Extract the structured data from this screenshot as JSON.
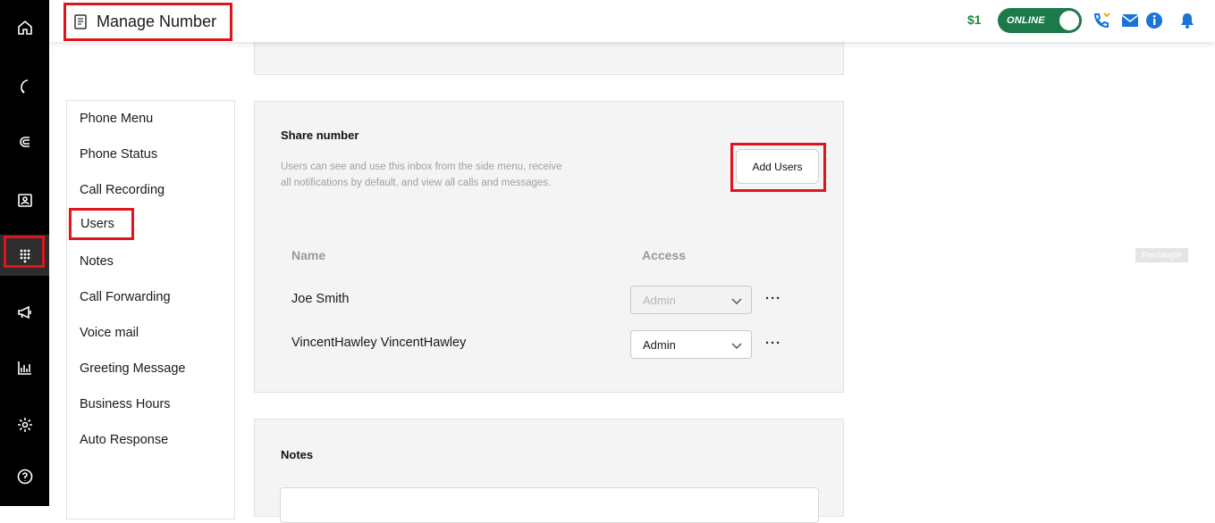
{
  "header": {
    "title": "Manage Number",
    "balance": "$1",
    "status_toggle": "ONLINE"
  },
  "rail": {
    "items": [
      "home-icon",
      "phone-icon",
      "magnet-icon",
      "contact-card-icon",
      "dialpad-icon",
      "megaphone-icon",
      "analytics-icon",
      "settings-icon",
      "help-icon"
    ],
    "active": "dialpad-icon"
  },
  "subnav": {
    "items": [
      "Phone Menu",
      "Phone Status",
      "Call Recording",
      "Users",
      "Notes",
      "Call Forwarding",
      "Voice mail",
      "Greeting Message",
      "Business Hours",
      "Auto Response"
    ],
    "active": "Users"
  },
  "share": {
    "title": "Share number",
    "description": "Users can see and use this inbox from the side menu, receive all notifications by default, and view all calls and messages.",
    "add_button": "Add Users",
    "columns": {
      "name": "Name",
      "access": "Access"
    },
    "users": [
      {
        "name": "Joe Smith",
        "access": "Admin",
        "disabled": true
      },
      {
        "name": "VincentHawley VincentHawley",
        "access": "Admin",
        "disabled": false
      }
    ],
    "more": "···"
  },
  "notes": {
    "title": "Notes"
  },
  "overlay": {
    "rectangle_tag": "Rectangle"
  },
  "colors": {
    "highlight": "#e0141c",
    "online_green": "#1c7a4a",
    "balance_green": "#1f8a3e",
    "icon_blue": "#1a73d9"
  }
}
